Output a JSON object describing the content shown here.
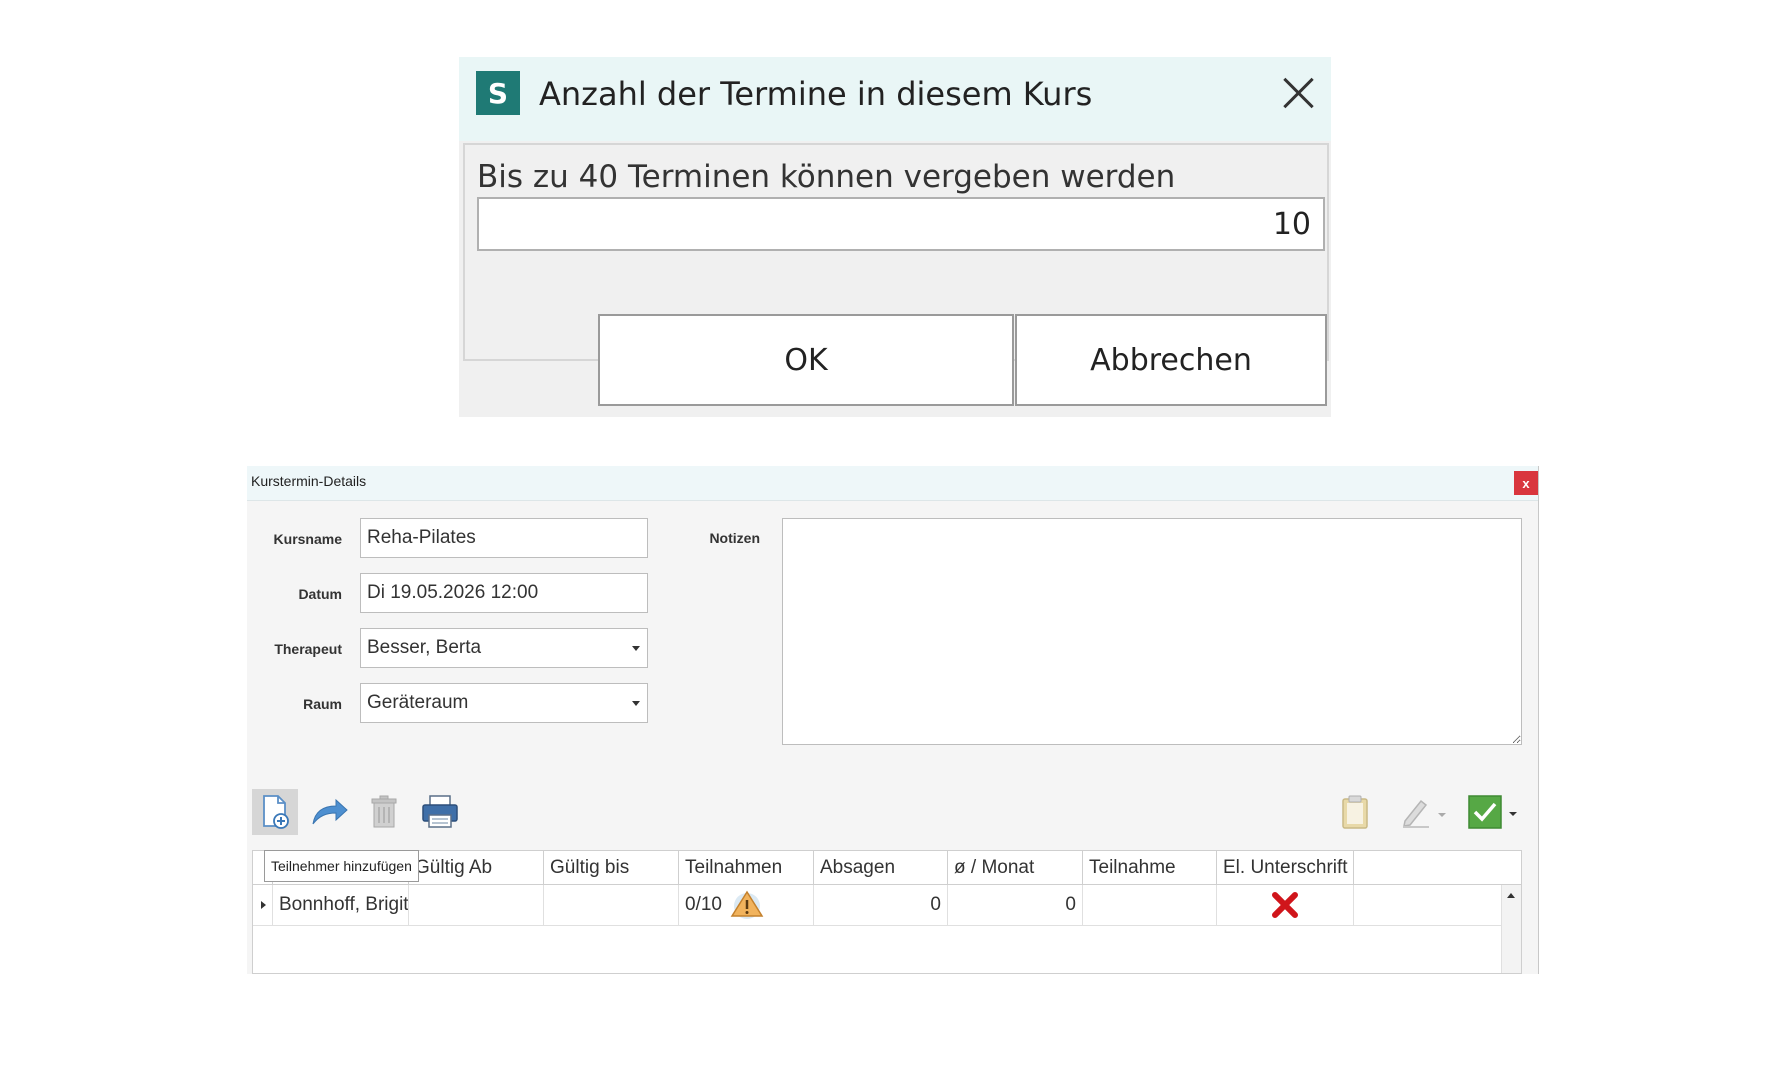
{
  "dialog": {
    "title": "Anzahl der Termine in diesem Kurs",
    "app_icon_letter": "S",
    "prompt": "Bis zu 40 Terminen können vergeben werden",
    "count_value": "10",
    "ok_label": "OK",
    "cancel_label": "Abbrechen"
  },
  "window": {
    "title": "Kurstermin-Details",
    "close_label": "x",
    "fields": {
      "kursname_label": "Kursname",
      "kursname_value": "Reha-Pilates",
      "datum_label": "Datum",
      "datum_value": "Di 19.05.2026 12:00",
      "therapeut_label": "Therapeut",
      "therapeut_value": "Besser, Berta",
      "raum_label": "Raum",
      "raum_value": "Geräteraum",
      "notizen_label": "Notizen"
    },
    "toolbar": {
      "tooltip": "Teilnehmer hinzufügen"
    },
    "table": {
      "columns": [
        "",
        "Gültig Ab",
        "Gültig bis",
        "Teilnahmen",
        "Absagen",
        "ø / Monat",
        "Teilnahme",
        "El. Unterschrift"
      ],
      "rows": [
        {
          "name": "Bonnhoff, Brigitte",
          "gueltig_ab": "",
          "gueltig_bis": "",
          "teilnahmen": "0/10",
          "absagen": "0",
          "monat": "0",
          "teilnahme": ""
        }
      ]
    }
  },
  "colors": {
    "app_icon": "#1f7a75",
    "title_bar": "#e9f6f6",
    "close_red": "#d9363e",
    "signature_missing": "#d0151b",
    "warning_orange": "#e8a04a"
  }
}
